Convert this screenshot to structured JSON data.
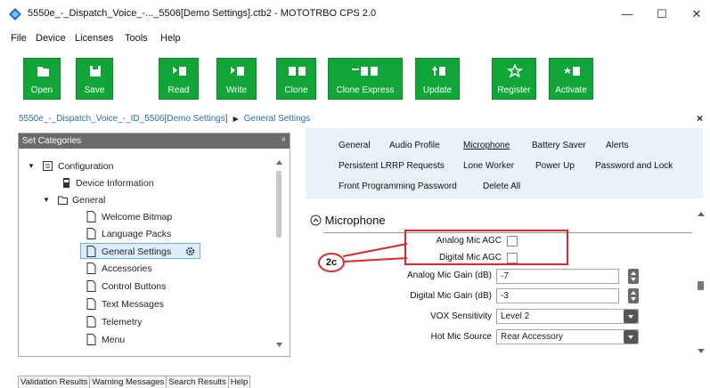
{
  "window": {
    "title": "5550e_-_Dispatch_Voice_-..._5506[Demo Settings].ctb2 - MOTOTRBO CPS 2.0",
    "minimize": "—",
    "maximize": "☐",
    "close": "✕"
  },
  "menu": [
    "File",
    "Device",
    "Licenses",
    "Tools",
    "Help"
  ],
  "toolbar": [
    {
      "label": "Open",
      "icon": "folder-icon"
    },
    {
      "label": "Save",
      "icon": "save-icon"
    },
    {
      "label": "Read",
      "icon": "read-icon"
    },
    {
      "label": "Write",
      "icon": "write-icon"
    },
    {
      "label": "Clone",
      "icon": "clone-icon"
    },
    {
      "label": "Clone Express",
      "icon": "clone-express-icon"
    },
    {
      "label": "Update",
      "icon": "update-icon"
    },
    {
      "label": "Register",
      "icon": "star-icon"
    },
    {
      "label": "Activate",
      "icon": "activate-icon"
    }
  ],
  "breadcrumb": {
    "root": "5550e_-_Dispatch_Voice_-_ID_5506[Demo Settings]",
    "sep": "▶",
    "current": "General Settings",
    "close": "×"
  },
  "left_panel": {
    "header": "Set Categories",
    "pin": "ᵖ",
    "tree": [
      {
        "label": "Configuration"
      },
      {
        "label": "Device Information"
      },
      {
        "label": "General"
      },
      {
        "label": "Welcome Bitmap"
      },
      {
        "label": "Language Packs"
      },
      {
        "label": "General Settings"
      },
      {
        "label": "Accessories"
      },
      {
        "label": "Control Buttons"
      },
      {
        "label": "Text Messages"
      },
      {
        "label": "Telemetry"
      },
      {
        "label": "Menu"
      }
    ]
  },
  "tabs": {
    "row1": [
      "General",
      "Audio Profile",
      "Microphone",
      "Battery Saver",
      "Alerts"
    ],
    "row2": [
      "Persistent LRRP Requests",
      "Lone Worker",
      "Power Up",
      "Password and Lock"
    ],
    "row3": [
      "Front Programming Password",
      "Delete All"
    ],
    "active": "Microphone"
  },
  "section": {
    "title": "Microphone",
    "toggle": "⌃"
  },
  "fields": {
    "analog_agc_label": "Analog Mic AGC",
    "digital_agc_label": "Digital Mic AGC",
    "analog_gain_label": "Analog Mic Gain (dB)",
    "analog_gain_value": "-7",
    "digital_gain_label": "Digital Mic Gain (dB)",
    "digital_gain_value": "-3",
    "vox_label": "VOX Sensitivity",
    "vox_value": "Level 2",
    "hotmic_label": "Hot Mic Source",
    "hotmic_value": "Rear Accessory"
  },
  "callout": "2c",
  "bottom_tabs": [
    "Validation Results",
    "Warning Messages",
    "Search Results",
    "Help"
  ],
  "colors": {
    "toolbar_green": "#11a537",
    "highlight_red": "#e0262b",
    "tab_bg": "#e8f2fb"
  }
}
